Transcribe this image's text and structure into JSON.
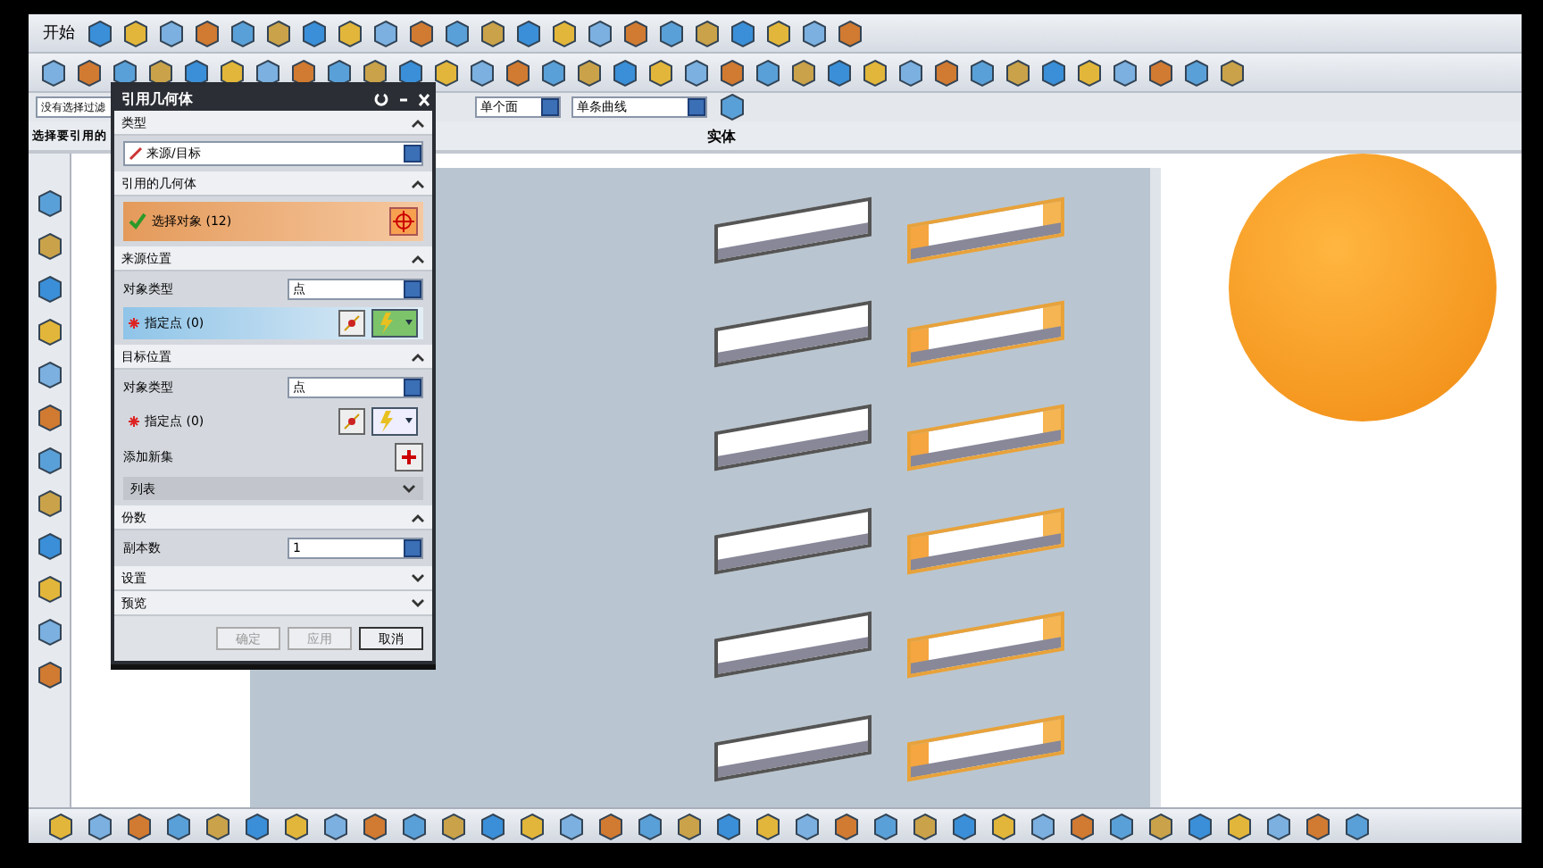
{
  "toolbar": {
    "start_label": "开始"
  },
  "selection_bar": {
    "filter": "没有选择过滤",
    "face_rule": "单个面",
    "curve_rule": "单条曲线"
  },
  "prompt": "选择要引用的",
  "body_label": "实体",
  "dialog": {
    "title": "引用几何体",
    "sections": [
      {
        "title": "类型",
        "expanded": true,
        "rows": [
          {
            "kind": "type",
            "value": "来源/目标"
          }
        ]
      },
      {
        "title": "引用的几何体",
        "expanded": true,
        "rows": [
          {
            "kind": "selection",
            "label": "选择对象 (12)",
            "done": true
          }
        ]
      },
      {
        "title": "来源位置",
        "expanded": true,
        "rows": [
          {
            "kind": "dropdown",
            "label": "对象类型",
            "value": "点"
          },
          {
            "kind": "point",
            "label": "指定点 (0)",
            "active": true
          }
        ]
      },
      {
        "title": "目标位置",
        "expanded": true,
        "rows": [
          {
            "kind": "dropdown",
            "label": "对象类型",
            "value": "点"
          },
          {
            "kind": "point",
            "label": "指定点 (0)",
            "active": false
          },
          {
            "kind": "add",
            "label": "添加新集"
          },
          {
            "kind": "list",
            "label": "列表"
          }
        ]
      },
      {
        "title": "份数",
        "expanded": true,
        "rows": [
          {
            "kind": "number",
            "label": "副本数",
            "value": "1"
          }
        ]
      },
      {
        "title": "设置",
        "expanded": false
      },
      {
        "title": "预览",
        "expanded": false
      }
    ],
    "buttons": [
      {
        "label": "确定",
        "disabled": true
      },
      {
        "label": "应用",
        "disabled": true
      },
      {
        "label": "取消",
        "disabled": false
      }
    ]
  },
  "slots": [
    {
      "selected": false
    },
    {
      "selected": true
    },
    {
      "selected": false
    },
    {
      "selected": true
    },
    {
      "selected": false
    },
    {
      "selected": true
    },
    {
      "selected": false
    },
    {
      "selected": true
    },
    {
      "selected": false
    },
    {
      "selected": true
    },
    {
      "selected": false
    },
    {
      "selected": true
    }
  ]
}
